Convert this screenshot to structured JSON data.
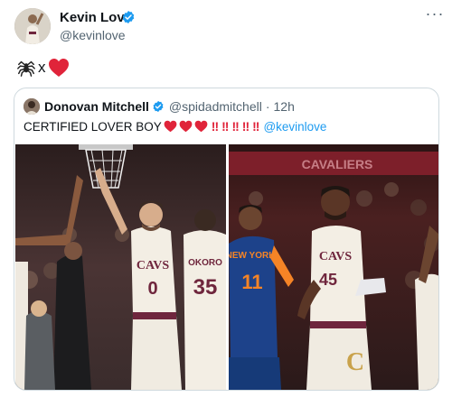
{
  "tweet": {
    "author_name": "Kevin Love",
    "author_handle": "@kevinlove",
    "more_label": "···",
    "text_separator": "x"
  },
  "quote": {
    "author_name": "Donovan Mitchell",
    "author_handle": "@spidadmitchell",
    "dot": "·",
    "time": "12h",
    "text": "CERTIFIED LOVER BOY",
    "exclaims": [
      "!!",
      "!!",
      "!!",
      "!!",
      "!!"
    ],
    "mention": "@kevinlove"
  },
  "photo_left": {
    "jersey_main_team": "CAVS",
    "jersey_main_number": "0",
    "jersey_back_name": "OKORO",
    "jersey_back_number": "35"
  },
  "photo_right": {
    "opponent_team": "NEW YORK",
    "opponent_number": "11",
    "jersey_team": "CAVS",
    "jersey_number": "45",
    "banner": "CAVALIERS"
  },
  "colors": {
    "verified": "#1d9bf0",
    "heart": "#e0243a",
    "link": "#1d9bf0",
    "muted": "#536471",
    "wine": "#6f263d",
    "knicks_blue": "#1d428a",
    "knicks_orange": "#f58426"
  },
  "icons": {
    "spider": "spider-icon",
    "heart": "red-heart-icon",
    "verified": "verified-badge-icon",
    "more": "more-options-icon"
  }
}
